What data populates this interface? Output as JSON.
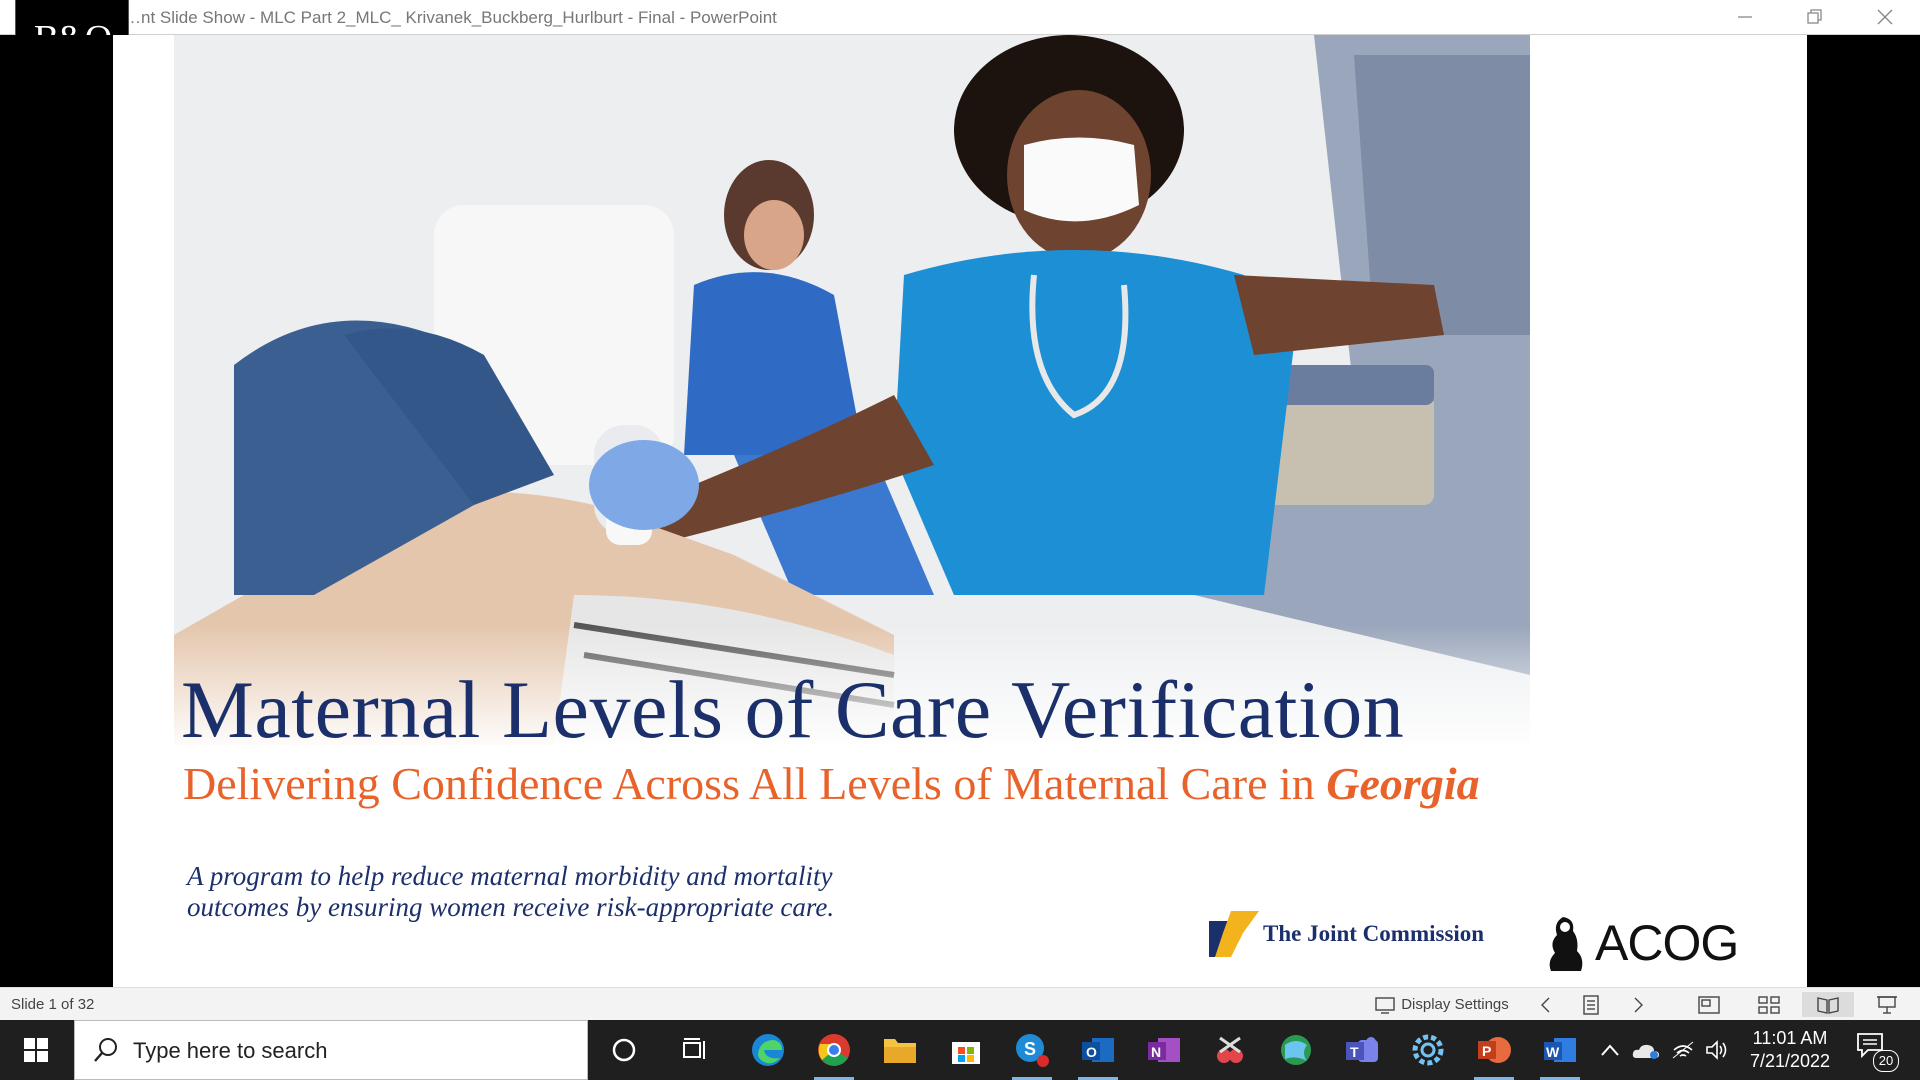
{
  "window": {
    "title": "…nt Slide Show  -  MLC Part 2_MLC_ Krivanek_Buckberg_Hurlburt - Final - PowerPoint",
    "overlay_logo": "B&O"
  },
  "slide": {
    "title": "Maternal Levels of Care Verification",
    "subtitle_prefix": "Delivering Confidence Across All Levels of Maternal Care in ",
    "subtitle_emphasis": "Georgia",
    "tagline_line1": "A program to help reduce maternal morbidity and mortality",
    "tagline_line2": "outcomes by ensuring women receive risk-appropriate care.",
    "logos": {
      "joint_commission": "The Joint Commission",
      "acog": "ACOG"
    },
    "colors": {
      "title": "#1b2f6b",
      "subtitle": "#e8632b",
      "tjc_gold": "#f2b31c"
    }
  },
  "statusbar": {
    "slide_info": "Slide 1 of 32",
    "display_settings": "Display Settings"
  },
  "taskbar": {
    "search_placeholder": "Type here to search",
    "time": "11:01 AM",
    "date": "7/21/2022",
    "notification_count": "20",
    "apps": [
      "cortana",
      "task-view",
      "edge",
      "chrome",
      "file-explorer",
      "microsoft-store",
      "skype-for-business",
      "outlook",
      "onenote",
      "snipping-tool",
      "maps",
      "teams",
      "settings",
      "powerpoint",
      "word"
    ]
  }
}
